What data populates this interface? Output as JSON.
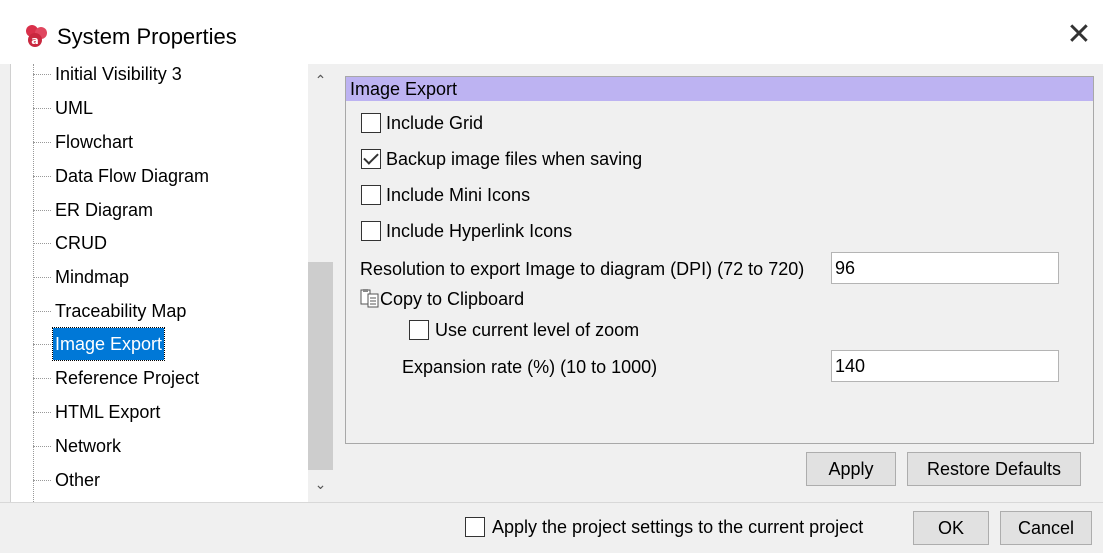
{
  "window": {
    "title": "System Properties",
    "close_glyph": "✕"
  },
  "tree": {
    "items": [
      {
        "label": "Initial Visibility 3"
      },
      {
        "label": "UML"
      },
      {
        "label": "Flowchart"
      },
      {
        "label": "Data Flow Diagram"
      },
      {
        "label": "ER Diagram"
      },
      {
        "label": "CRUD"
      },
      {
        "label": "Mindmap"
      },
      {
        "label": "Traceability Map"
      },
      {
        "label": "Image Export"
      },
      {
        "label": "Reference Project"
      },
      {
        "label": "HTML Export"
      },
      {
        "label": "Network"
      },
      {
        "label": "Other"
      }
    ],
    "selected": "Image Export",
    "scroll_up_glyph": "⌃",
    "scroll_down_glyph": "⌄"
  },
  "panel": {
    "header": "Image Export",
    "include_grid": {
      "label": "Include Grid",
      "checked": false
    },
    "backup_images": {
      "label": "Backup image files when saving",
      "checked": true
    },
    "include_mini_icons": {
      "label": "Include Mini Icons",
      "checked": false
    },
    "include_hyperlink_icons": {
      "label": "Include Hyperlink Icons",
      "checked": false
    },
    "resolution": {
      "label": "Resolution to export Image to diagram (DPI) (72 to 720)",
      "value": "96"
    },
    "clipboard": {
      "label": "Copy to Clipboard"
    },
    "use_zoom": {
      "label": "Use current level of zoom",
      "checked": false
    },
    "expansion": {
      "label": "Expansion rate (%) (10 to 1000)",
      "value": "140"
    }
  },
  "buttons": {
    "apply": "Apply",
    "restore_defaults": "Restore Defaults",
    "ok": "OK",
    "cancel": "Cancel"
  },
  "footer": {
    "apply_project": {
      "label": "Apply the project settings to the current project",
      "checked": false
    }
  },
  "colors": {
    "header_bg": "#bdb3f2",
    "selection": "#0078d7",
    "app_icon": "#d9304a"
  }
}
